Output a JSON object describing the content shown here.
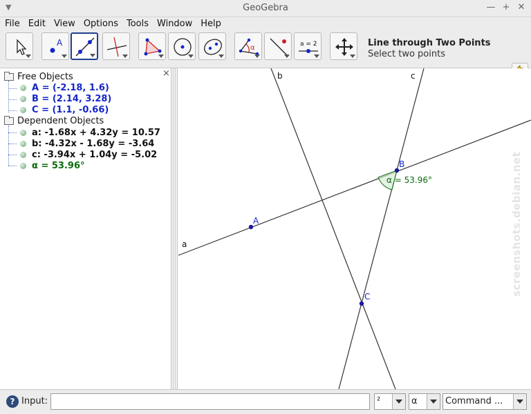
{
  "window": {
    "title": "GeoGebra"
  },
  "menu": [
    "File",
    "Edit",
    "View",
    "Options",
    "Tools",
    "Window",
    "Help"
  ],
  "toolbar": {
    "active_tool_name": "Line through Two Points",
    "active_tool_help": "Select two points",
    "tool_icons": [
      "move-tool-icon",
      "point-tool-icon",
      "line-tool-icon",
      "perpendicular-tool-icon",
      "polygon-tool-icon",
      "circle-tool-icon",
      "ellipse-tool-icon",
      "angle-tool-icon",
      "reflect-tool-icon",
      "slider-tool-icon",
      "move-graphics-tool-icon"
    ],
    "slider_label": "a = 2",
    "point_label": "A",
    "angle_label": "α"
  },
  "algebra": {
    "free_header": "Free Objects",
    "dependent_header": "Dependent Objects",
    "free": [
      {
        "text": "A = (-2.18, 1.6)"
      },
      {
        "text": "B = (2.14, 3.28)"
      },
      {
        "text": "C = (1.1, -0.66)"
      }
    ],
    "dependent": [
      {
        "text": "a: -1.68x + 4.32y = 10.57"
      },
      {
        "text": "b: -4.32x - 1.68y = -3.64"
      },
      {
        "text": "c: -3.94x + 1.04y = -5.02"
      },
      {
        "text": "α = 53.96°"
      }
    ],
    "close_label": "×"
  },
  "graphics": {
    "labels": {
      "line_a": "a",
      "line_b": "b",
      "line_c": "c",
      "point_A": "A",
      "point_B": "B",
      "point_C": "C",
      "angle": "α = 53.96°"
    }
  },
  "watermark": "screenshots.debian.net",
  "input_bar": {
    "help_label": "?",
    "label": "Input:",
    "value": "",
    "superscript_combo": "²",
    "symbol_combo": "α",
    "command_combo": "Command ..."
  },
  "colors": {
    "selected_tool_border": "#1f3f8f",
    "point_blue": "#1426c9",
    "angle_green": "#0b6b0b"
  }
}
